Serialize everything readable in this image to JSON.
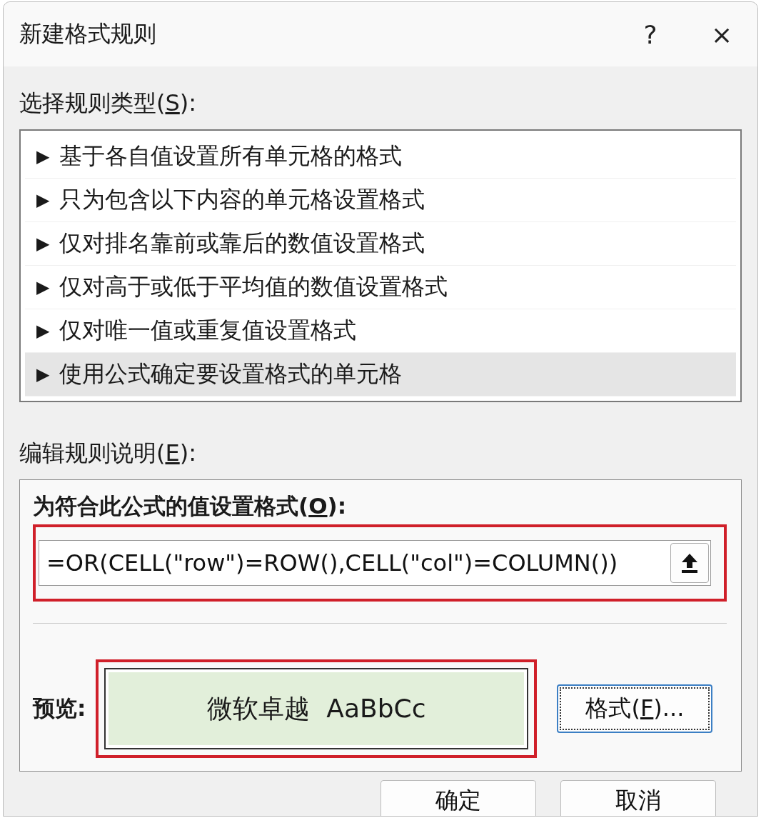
{
  "window": {
    "title": "新建格式规则",
    "help": "?",
    "close": "×"
  },
  "rule_type": {
    "label": {
      "before": "选择规则类型(",
      "key": "S",
      "after": "):"
    },
    "items": [
      {
        "arrow": "▶",
        "label": "基于各自值设置所有单元格的格式",
        "selected": false
      },
      {
        "arrow": "▶",
        "label": "只为包含以下内容的单元格设置格式",
        "selected": false
      },
      {
        "arrow": "▶",
        "label": "仅对排名靠前或靠后的数值设置格式",
        "selected": false
      },
      {
        "arrow": "▶",
        "label": "仅对高于或低于平均值的数值设置格式",
        "selected": false
      },
      {
        "arrow": "▶",
        "label": "仅对唯一值或重复值设置格式",
        "selected": false
      },
      {
        "arrow": "▶",
        "label": "使用公式确定要设置格式的单元格",
        "selected": true
      }
    ]
  },
  "edit": {
    "label": {
      "before": "编辑规则说明(",
      "key": "E",
      "after": "):"
    },
    "formula_label": {
      "before": "为符合此公式的值设置格式(",
      "key": "O",
      "after": "):"
    },
    "formula": {
      "value": "=OR(CELL(\"row\")=ROW(),CELL(\"col\")=COLUMN())",
      "highlighted": true
    },
    "preview_label": "预览:",
    "preview": {
      "text": "微软卓越  AaBbCc",
      "highlighted": true
    },
    "format_button": {
      "label": {
        "before": "格式(",
        "key": "F",
        "after": ")..."
      },
      "focused": true
    }
  },
  "buttons": [
    "确定",
    "取消"
  ]
}
